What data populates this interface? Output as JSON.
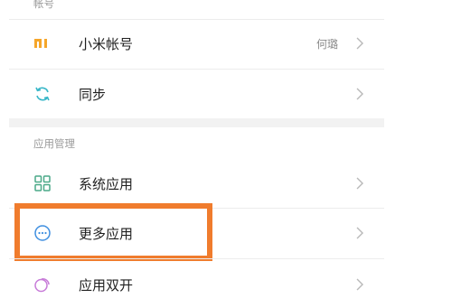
{
  "sections": {
    "account": {
      "header": "帐号",
      "items": [
        {
          "label": "小米帐号",
          "value": "何璐",
          "icon": "mi-logo-icon"
        },
        {
          "label": "同步",
          "icon": "sync-icon"
        }
      ]
    },
    "apps": {
      "header": "应用管理",
      "items": [
        {
          "label": "系统应用",
          "icon": "grid-apps-icon"
        },
        {
          "label": "更多应用",
          "icon": "more-dots-icon"
        },
        {
          "label": "应用双开",
          "icon": "dual-apps-icon"
        }
      ]
    }
  },
  "colors": {
    "highlight": "#f07c2d",
    "mi_orange": "#f5a62a",
    "sync_teal": "#39b7c8",
    "grid_green": "#4aa988",
    "more_blue": "#3f8fe0",
    "dual_purple": "#c77bd8"
  }
}
